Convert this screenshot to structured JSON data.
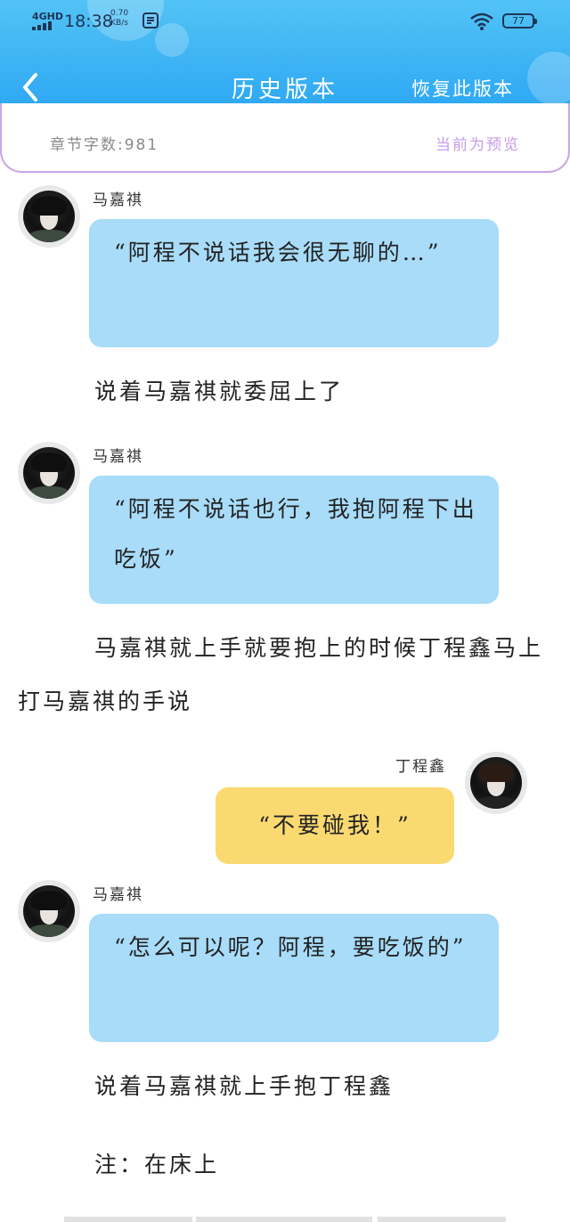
{
  "status_bar": {
    "network": "4GHD",
    "time": "18:38",
    "speed_value": "0.70",
    "speed_unit": "KB/s",
    "battery": "77"
  },
  "header": {
    "title": "历史版本",
    "restore_label": "恢复此版本"
  },
  "info": {
    "word_count": "章节字数:981",
    "preview_label": "当前为预览"
  },
  "chapter": {
    "block1": {
      "speaker": "马嘉祺",
      "text": "“阿程不说话我会很无聊的…”"
    },
    "narration1": "说着马嘉祺就委屈上了",
    "block2": {
      "speaker": "马嘉祺",
      "text": "“阿程不说话也行，我抱阿程下出吃饭”"
    },
    "narration2": "马嘉祺就上手就要抱上的时候丁程鑫马上打马嘉祺的手说",
    "block3": {
      "speaker": "丁程鑫",
      "text": "“不要碰我！”"
    },
    "block4": {
      "speaker": "马嘉祺",
      "text": "“怎么可以呢？阿程，要吃饭的”"
    },
    "narration3": "说着马嘉祺就上手抱丁程鑫",
    "narration4": "注：在床上"
  },
  "colors": {
    "header": "#2aa5f3",
    "bubble_blue": "#a8dcf9",
    "bubble_yellow": "#fbd971",
    "preview_accent": "#c79be8"
  }
}
